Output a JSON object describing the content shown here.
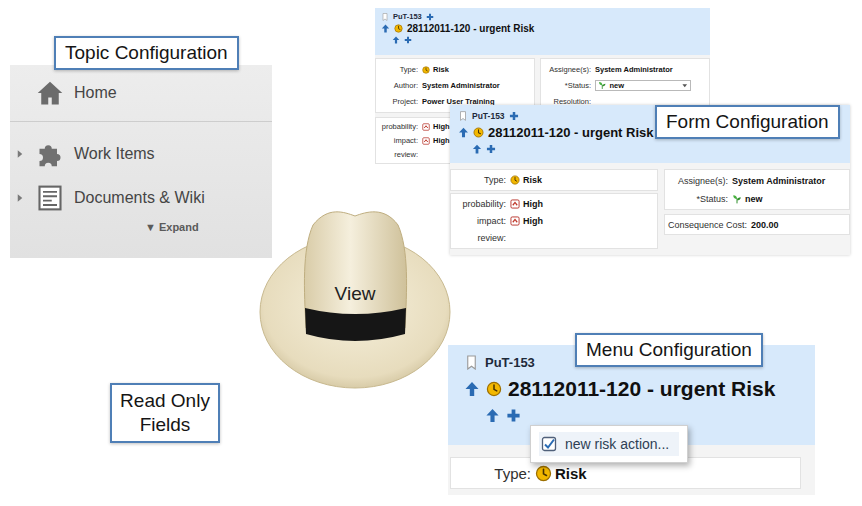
{
  "topic_configuration": {
    "label": "Topic Configuration",
    "items": [
      {
        "label": "Home",
        "expandable": false,
        "icon": "home"
      },
      {
        "label": "Work Items",
        "expandable": true,
        "icon": "puzzle"
      },
      {
        "label": "Documents & Wiki",
        "expandable": true,
        "icon": "document"
      }
    ],
    "expand": "▼ Expand"
  },
  "hat": {
    "label": "View"
  },
  "read_only": {
    "label": "Read Only Fields"
  },
  "work_item_view": {
    "id": "PuT-153",
    "title": "28112011-120 - urgent Risk",
    "left": [
      {
        "label": "Type:",
        "value": "Risk",
        "kind": "type"
      },
      {
        "label": "Author:",
        "value": "System Administrator",
        "kind": "text"
      },
      {
        "label": "Project:",
        "value": "Power User Training",
        "kind": "text"
      }
    ],
    "right": [
      {
        "label": "Assignee(s):",
        "value": "System Administrator",
        "kind": "text"
      },
      {
        "label": "*Status:",
        "value": "new",
        "kind": "select"
      },
      {
        "label": "Resolution:",
        "value": "",
        "kind": "text"
      }
    ],
    "custom": [
      {
        "label": "probability:",
        "value": "High",
        "kind": "level"
      },
      {
        "label": "impact:",
        "value": "High",
        "kind": "level"
      },
      {
        "label": "review:",
        "value": "",
        "kind": "text"
      }
    ]
  },
  "form_configuration": {
    "label": "Form Configuration",
    "id": "PuT-153",
    "title": "28112011-120 - urgent Risk",
    "left": [
      {
        "label": "Type:",
        "value": "Risk",
        "kind": "type"
      }
    ],
    "custom": [
      {
        "label": "probability:",
        "value": "High",
        "kind": "level"
      },
      {
        "label": "impact:",
        "value": "High",
        "kind": "level"
      },
      {
        "label": "review:",
        "value": "",
        "kind": "text"
      }
    ],
    "right": [
      {
        "label": "Assignee(s):",
        "value": "System Administrator",
        "kind": "text"
      },
      {
        "label": "*Status:",
        "value": "new",
        "kind": "status"
      }
    ],
    "extra": [
      {
        "label": "Consequence Cost:",
        "value": "200.00",
        "kind": "text"
      }
    ]
  },
  "menu_configuration": {
    "label": "Menu Configuration",
    "id": "PuT-153",
    "title": "28112011-120 - urgent Risk",
    "menu": [
      {
        "label": "new risk action...",
        "checked": true
      }
    ],
    "fields": [
      {
        "label": "Type:",
        "value": "Risk",
        "kind": "type"
      }
    ]
  }
}
